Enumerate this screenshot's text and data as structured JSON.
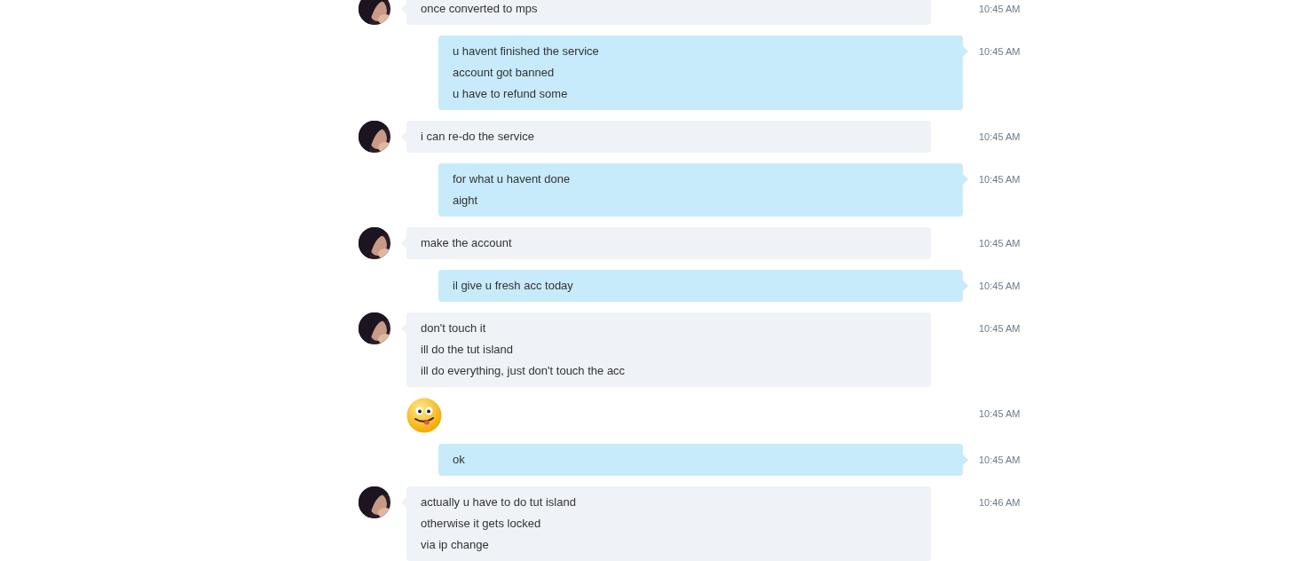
{
  "messages": [
    {
      "kind": "received",
      "lines": [
        "once converted to mps"
      ],
      "time": "10:45 AM"
    },
    {
      "kind": "sent",
      "lines": [
        "u havent finished the service",
        "account got banned",
        "u have to refund some"
      ],
      "time": "10:45 AM"
    },
    {
      "kind": "received",
      "lines": [
        "i can re-do the service"
      ],
      "time": "10:45 AM"
    },
    {
      "kind": "sent",
      "lines": [
        "for what u havent done",
        "aight"
      ],
      "time": "10:45 AM"
    },
    {
      "kind": "received",
      "lines": [
        "make the account"
      ],
      "time": "10:45 AM"
    },
    {
      "kind": "sent",
      "lines": [
        "il give u fresh acc today"
      ],
      "time": "10:45 AM"
    },
    {
      "kind": "received",
      "lines": [
        "don't touch it",
        "ill do the tut island",
        "ill do everything, just don't touch the acc"
      ],
      "time": "10:45 AM"
    },
    {
      "kind": "emoji",
      "time": "10:45 AM"
    },
    {
      "kind": "sent",
      "lines": [
        "ok"
      ],
      "time": "10:45 AM"
    },
    {
      "kind": "received",
      "lines": [
        "actually u have to do tut island",
        "otherwise it gets locked",
        "via ip change"
      ],
      "time": "10:46 AM"
    }
  ]
}
